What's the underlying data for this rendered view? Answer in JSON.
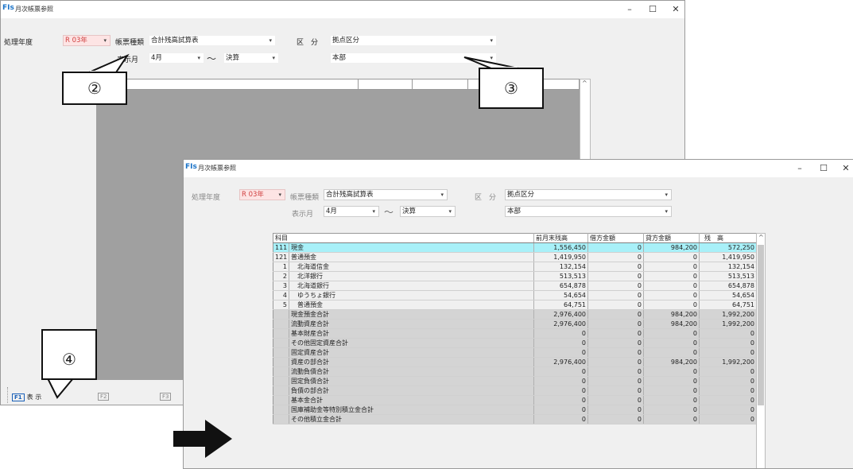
{
  "back_window": {
    "title": "月次帳票参照",
    "app_icon": "FIs",
    "win_min": "–",
    "win_max": "☐",
    "win_close": "✕",
    "year_label": "処理年度",
    "year_value": "R 03年",
    "report_type_label": "帳票種類",
    "report_type_value": "合計残高試算表",
    "division_label": "区　分",
    "division_value": "拠点区分",
    "display_month_label": "表示月",
    "month_from": "4月",
    "tilde": "～",
    "month_to": "決算",
    "branch_value": "本部",
    "fkeys": [
      {
        "key": "F1",
        "label": "表 示"
      },
      {
        "key": "F2",
        "label": ""
      },
      {
        "key": "F3",
        "label": ""
      }
    ]
  },
  "callouts": [
    "②",
    "③",
    "④"
  ],
  "front_window": {
    "title": "月次帳票参照",
    "app_icon": "FIs",
    "win_min": "–",
    "win_max": "☐",
    "win_close": "✕",
    "year_label": "処理年度",
    "year_value": "R 03年",
    "report_type_label": "帳票種類",
    "report_type_value": "合計残高試算表",
    "division_label": "区　分",
    "division_value": "拠点区分",
    "display_month_label": "表示月",
    "month_from": "4月",
    "tilde": "～",
    "month_to": "決算",
    "branch_value": "本部",
    "table": {
      "headers": [
        "科目",
        "前月末残高",
        "借方金額",
        "貸方金額",
        "残　高"
      ],
      "rows": [
        {
          "code": "111",
          "name": "現金",
          "prev": "1,556,450",
          "debit": "0",
          "credit": "984,200",
          "balance": "572,250",
          "style": "sel"
        },
        {
          "code": "121",
          "name": "普通預金",
          "prev": "1,419,950",
          "debit": "0",
          "credit": "0",
          "balance": "1,419,950",
          "style": ""
        },
        {
          "code": "1",
          "name": "　北海道信金",
          "prev": "132,154",
          "debit": "0",
          "credit": "0",
          "balance": "132,154",
          "style": ""
        },
        {
          "code": "2",
          "name": "　北洋銀行",
          "prev": "513,513",
          "debit": "0",
          "credit": "0",
          "balance": "513,513",
          "style": ""
        },
        {
          "code": "3",
          "name": "　北海道銀行",
          "prev": "654,878",
          "debit": "0",
          "credit": "0",
          "balance": "654,878",
          "style": ""
        },
        {
          "code": "4",
          "name": "　ゆうちょ銀行",
          "prev": "54,654",
          "debit": "0",
          "credit": "0",
          "balance": "54,654",
          "style": ""
        },
        {
          "code": "5",
          "name": "　普通預金",
          "prev": "64,751",
          "debit": "0",
          "credit": "0",
          "balance": "64,751",
          "style": ""
        },
        {
          "code": "",
          "name": "現金預金合計",
          "prev": "2,976,400",
          "debit": "0",
          "credit": "984,200",
          "balance": "1,992,200",
          "style": "sum"
        },
        {
          "code": "",
          "name": "流動資産合計",
          "prev": "2,976,400",
          "debit": "0",
          "credit": "984,200",
          "balance": "1,992,200",
          "style": "sum"
        },
        {
          "code": "",
          "name": "基本財産合計",
          "prev": "0",
          "debit": "0",
          "credit": "0",
          "balance": "0",
          "style": "sum"
        },
        {
          "code": "",
          "name": "その他固定資産合計",
          "prev": "0",
          "debit": "0",
          "credit": "0",
          "balance": "0",
          "style": "sum"
        },
        {
          "code": "",
          "name": "固定資産合計",
          "prev": "0",
          "debit": "0",
          "credit": "0",
          "balance": "0",
          "style": "sum"
        },
        {
          "code": "",
          "name": "資産の部合計",
          "prev": "2,976,400",
          "debit": "0",
          "credit": "984,200",
          "balance": "1,992,200",
          "style": "sum"
        },
        {
          "code": "",
          "name": "流動負債合計",
          "prev": "0",
          "debit": "0",
          "credit": "0",
          "balance": "0",
          "style": "sum"
        },
        {
          "code": "",
          "name": "固定負債合計",
          "prev": "0",
          "debit": "0",
          "credit": "0",
          "balance": "0",
          "style": "sum"
        },
        {
          "code": "",
          "name": "負債の部合計",
          "prev": "0",
          "debit": "0",
          "credit": "0",
          "balance": "0",
          "style": "sum"
        },
        {
          "code": "",
          "name": "基本金合計",
          "prev": "0",
          "debit": "0",
          "credit": "0",
          "balance": "0",
          "style": "sum"
        },
        {
          "code": "",
          "name": "国庫補助金等特別積立金合計",
          "prev": "0",
          "debit": "0",
          "credit": "0",
          "balance": "0",
          "style": "sum"
        },
        {
          "code": "",
          "name": "その他積立金合計",
          "prev": "0",
          "debit": "0",
          "credit": "0",
          "balance": "0",
          "style": "sum"
        }
      ]
    }
  },
  "colors": {
    "selected_row": "#a8f0f8",
    "summary_row": "#d4d4d4",
    "year_combo": "#fde4e4",
    "gray_grid": "#a0a0a0"
  }
}
